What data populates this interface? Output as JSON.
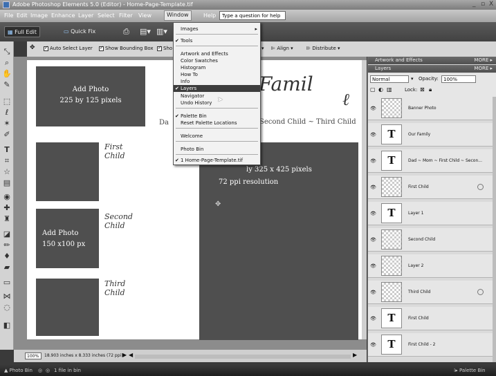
{
  "window": {
    "title": "Adobe Photoshop Elements 5.0 (Editor) - Home-Page-Template.tif",
    "controls": [
      "_",
      "▫",
      "X"
    ]
  },
  "menubar": {
    "items": [
      "File",
      "Edit",
      "Image",
      "Enhance",
      "Layer",
      "Select",
      "Filter",
      "View",
      "Window",
      "Help"
    ],
    "active": "Window",
    "help_search": "Type a question for help"
  },
  "shortcuts": {
    "full_edit": "Full Edit",
    "quick_fix": "Quick Fix"
  },
  "options": {
    "auto_select": "Auto Select Layer",
    "show_bounding_box": "Show Bounding Box",
    "show_truncated": "Sho",
    "align": "Align ▾",
    "distribute": "Distribute ▾"
  },
  "window_menu": {
    "items": [
      {
        "label": "Images",
        "checked": false,
        "submenu": true
      },
      {
        "label": "Tools",
        "checked": true
      },
      {
        "label": "Artwork and Effects",
        "checked": false
      },
      {
        "label": "Color Swatches",
        "checked": false
      },
      {
        "label": "Histogram",
        "checked": false
      },
      {
        "label": "How To",
        "checked": false
      },
      {
        "label": "Info",
        "checked": false
      },
      {
        "label": "Layers",
        "checked": true,
        "highlight": true
      },
      {
        "label": "Navigator",
        "checked": false
      },
      {
        "label": "Undo History",
        "checked": false
      },
      {
        "label": "Palette Bin",
        "checked": true
      },
      {
        "label": "Reset Palette Locations",
        "checked": false
      },
      {
        "label": "Welcome",
        "checked": false
      },
      {
        "label": "Photo Bin",
        "checked": false
      },
      {
        "label": "1 Home-Page-Template.tif",
        "checked": true
      }
    ]
  },
  "canvas": {
    "photo1_line1": "Add Photo",
    "photo1_line2": "225 by 125 pixels",
    "family_title": "Famil",
    "names_line": "Da",
    "names_line_right": "Second Child ~ Third Child",
    "first_child": "First Child",
    "second_child": "Second Child",
    "third_child": "Third Child",
    "photo2_line1": "Add Photo",
    "photo2_line2": "150 x100 px",
    "big_line1": "ly 325 x 425 pixels",
    "big_line2": "72 ppi resolution"
  },
  "status": {
    "zoom": "100%",
    "doc_info": "18.903 inches x 8.333 inches (72 ppi)"
  },
  "panel": {
    "artwork_title": "Artwork and Effects",
    "layers_title": "Layers",
    "more": "MORE ▸",
    "blend_mode": "Normal",
    "opacity_label": "Opacity:",
    "opacity_value": "100%",
    "lock_label": "Lock:",
    "layers": [
      {
        "name": "Banner Photo",
        "type": "image"
      },
      {
        "name": "Our Family",
        "type": "text"
      },
      {
        "name": "Dad ~ Mom ~ First Child ~ Secon...",
        "type": "text"
      },
      {
        "name": "First Child",
        "type": "image"
      },
      {
        "name": "Layer 1",
        "type": "text"
      },
      {
        "name": "Second Child",
        "type": "image"
      },
      {
        "name": "Layer 2",
        "type": "image"
      },
      {
        "name": "Third Child",
        "type": "image"
      },
      {
        "name": "First Child",
        "type": "text"
      },
      {
        "name": "First Child - 2",
        "type": "text"
      }
    ]
  },
  "bottombar": {
    "photo_bin": "Photo Bin",
    "files": "1 file in bin",
    "palette_bin": "Palette Bin"
  }
}
